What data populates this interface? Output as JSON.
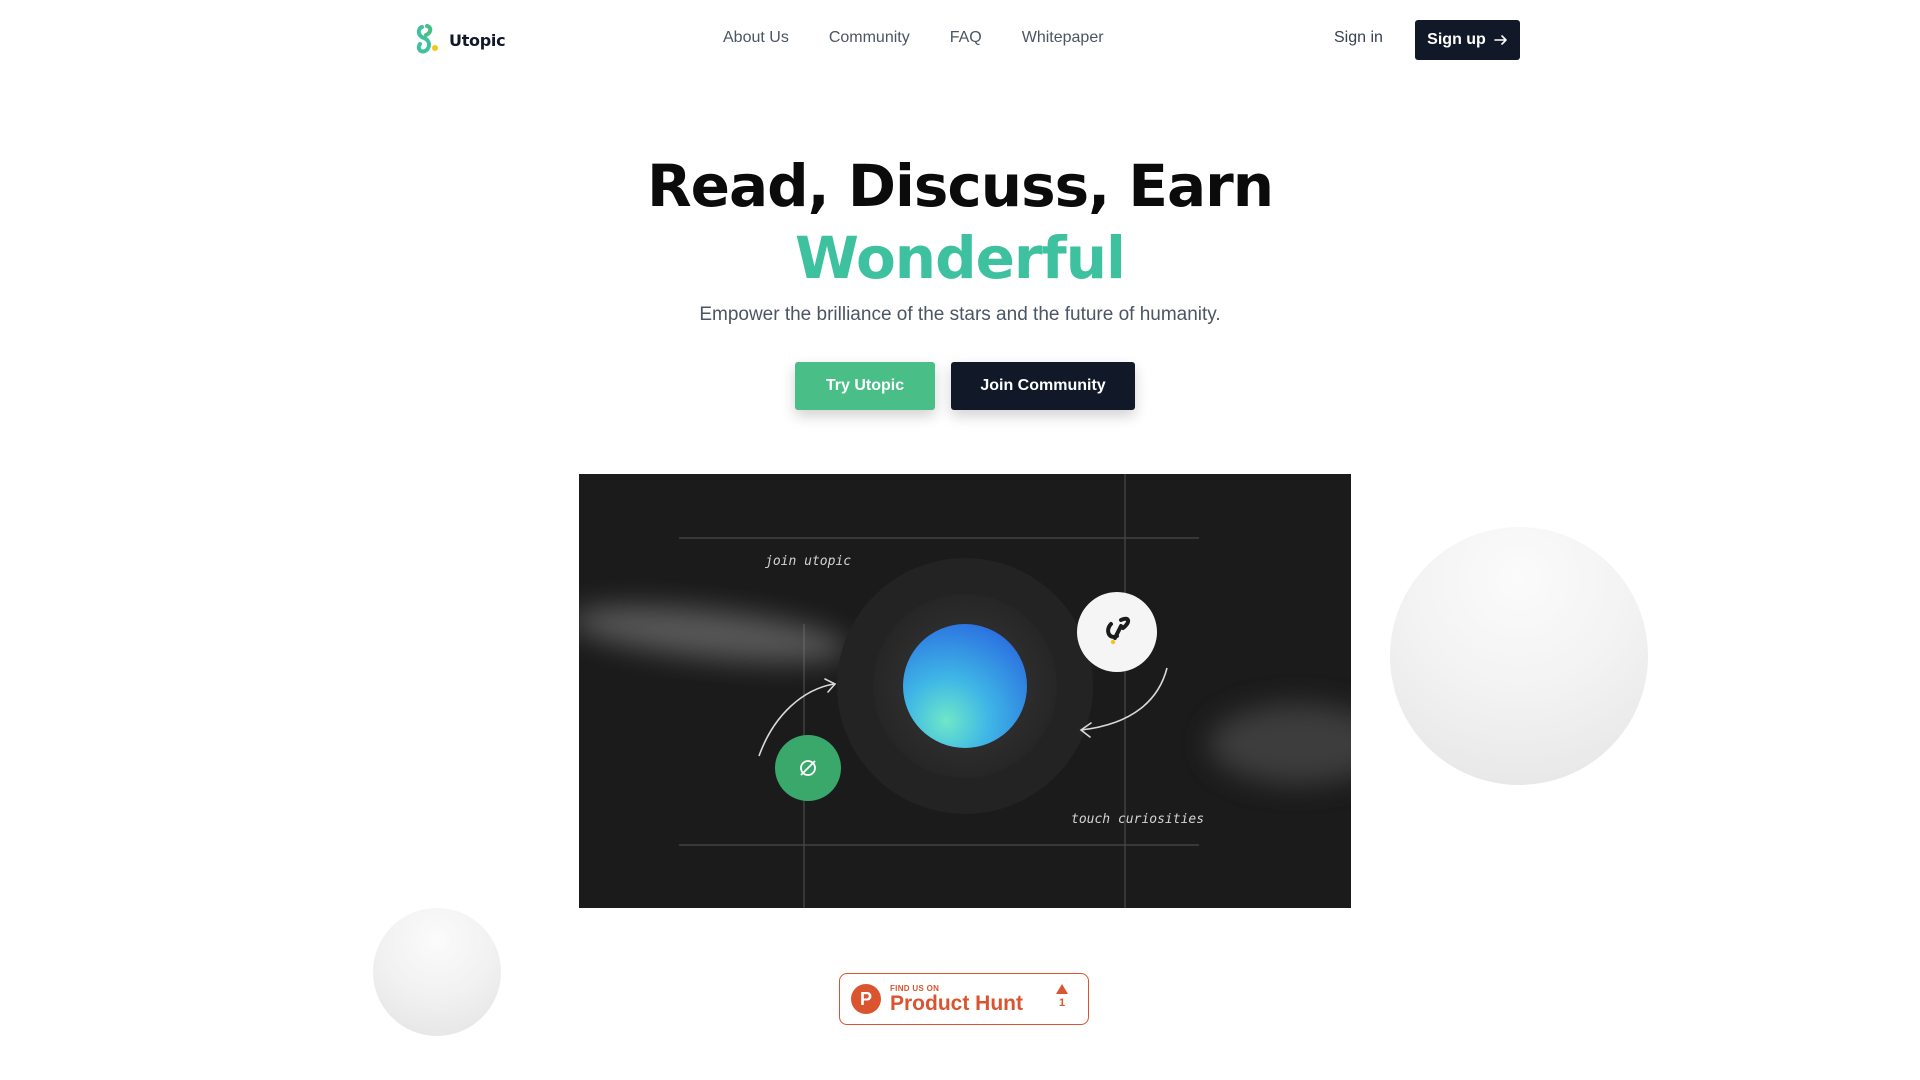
{
  "brand": {
    "name": "Utopic",
    "accent": "#3ec19f",
    "button_green": "#49bf87",
    "dark": "#111827"
  },
  "nav": {
    "items": [
      "About Us",
      "Community",
      "FAQ",
      "Whitepaper"
    ]
  },
  "auth": {
    "signin_label": "Sign in",
    "signup_label": "Sign up",
    "signup_icon": "arrow-right-icon"
  },
  "hero": {
    "title_line1": "Read, Discuss, Earn",
    "title_line2": "Wonderful",
    "subtitle": "Empower the brilliance of the stars and the future of humanity.",
    "cta_primary": "Try Utopic",
    "cta_secondary": "Join Community"
  },
  "video": {
    "note_join": "join utopic",
    "note_touch": "touch curiosities",
    "icons": [
      "planet-orb",
      "utopic-link-icon",
      "compass-icon"
    ]
  },
  "product_hunt": {
    "small_label": "FIND US ON",
    "label": "Product Hunt",
    "logo_letter": "P",
    "upvotes": "1",
    "color": "#da552f"
  }
}
